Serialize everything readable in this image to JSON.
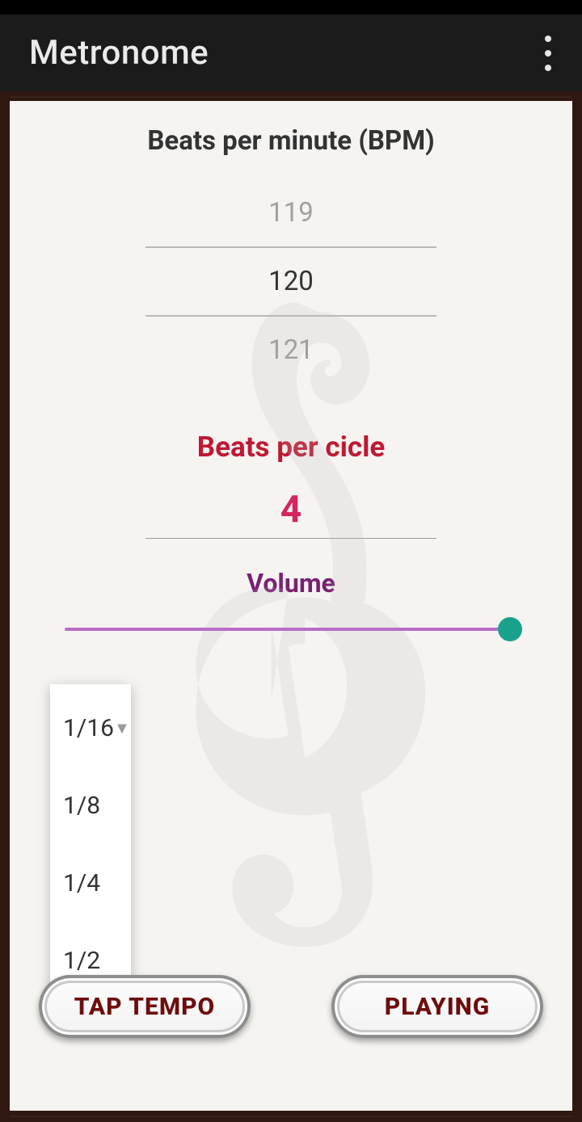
{
  "header": {
    "title": "Metronome"
  },
  "bpm": {
    "label": "Beats per minute (BPM)",
    "prev": "119",
    "current": "120",
    "next": "121"
  },
  "bpc": {
    "label": "Beats per cicle",
    "value": "4"
  },
  "volume": {
    "label": "Volume",
    "percent": 100
  },
  "noteMenu": {
    "selected": "1/16",
    "options": [
      "1/16",
      "1/8",
      "1/4",
      "1/2"
    ]
  },
  "buttons": {
    "tapTempo": "TAP TEMPO",
    "play": "PLAYING"
  }
}
